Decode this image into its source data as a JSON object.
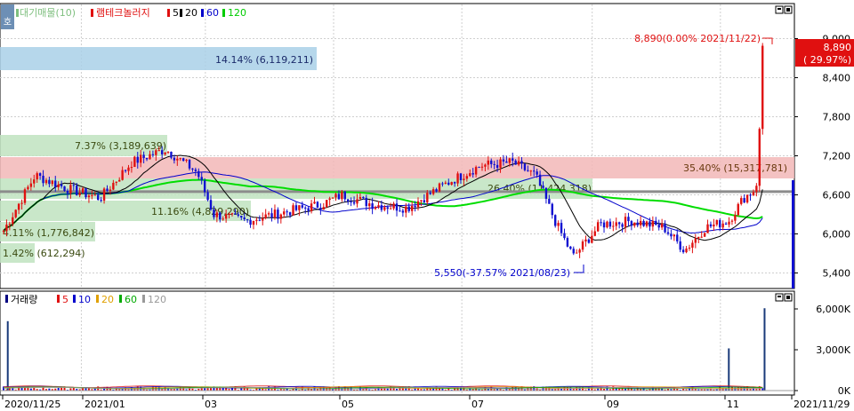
{
  "top_legend": {
    "mode_label": "호",
    "items": [
      {
        "label": "대기매물(10)",
        "color": "#7fbf7f"
      },
      {
        "label": "램테크놀러지",
        "color": "#e01010"
      },
      {
        "label": "5",
        "color": "#e01010"
      },
      {
        "label": "20",
        "color": "#000000"
      },
      {
        "label": "60",
        "color": "#0000cc"
      },
      {
        "label": "120",
        "color": "#00cc00"
      }
    ]
  },
  "bottom_legend": {
    "items": [
      {
        "label": "거래량",
        "color": "#000080"
      },
      {
        "label": "5",
        "color": "#e01010"
      },
      {
        "label": "10",
        "color": "#0000cc"
      },
      {
        "label": "20",
        "color": "#e0a000"
      },
      {
        "label": "60",
        "color": "#00aa00"
      },
      {
        "label": "120",
        "color": "#999999"
      }
    ]
  },
  "price_axis": {
    "ticks": [
      "9,000",
      "8,400",
      "7,800",
      "7,200",
      "6,600",
      "6,000",
      "5,400"
    ]
  },
  "volume_axis": {
    "ticks": [
      "6,000K",
      "3,000K",
      "0K"
    ]
  },
  "x_axis": {
    "ticks": [
      "2020/11/25",
      "2021/01",
      "03",
      "05",
      "07",
      "09",
      "11",
      "2021/11/29"
    ]
  },
  "price_tag": {
    "price": "8,890",
    "pct": "( 29.97%)"
  },
  "annotations": {
    "high": "8,890(0.00% 2021/11/22)",
    "low": "5,550(-37.57% 2021/08/23)"
  },
  "volume_profile": [
    {
      "label": "14.14% (6,119,211)",
      "color": "#a9d0e8"
    },
    {
      "label": "7.37% (3,189,639)",
      "color": "#bfe3bf"
    },
    {
      "label": "35.40% (15,317,781)",
      "color": "#f2b7b7"
    },
    {
      "label": "26.40% (11,424,318)",
      "color": "#bfe3bf"
    },
    {
      "label": "11.16% (4,829,290)",
      "color": "#bfe3bf"
    },
    {
      "label": "4.11% (1,776,842)",
      "color": "#bfe3bf"
    },
    {
      "label": "1.42% (612,294)",
      "color": "#bfe3bf"
    }
  ],
  "chart_data": {
    "type": "candlestick",
    "ticker": "램테크놀러지",
    "period": [
      "2020/11/25",
      "2021/11/29"
    ],
    "current_price": 8890,
    "current_change_pct": 29.97,
    "high": {
      "price": 8890,
      "date": "2021/11/22",
      "pct_from": 0.0
    },
    "low": {
      "price": 5550,
      "date": "2021/08/23",
      "pct_from": -37.57
    },
    "price_ylim": [
      5200,
      9200
    ],
    "volume_ylim_k": [
      0,
      6400
    ],
    "reference_line": 6650,
    "close_path": [
      [
        "2020/11/25",
        6050
      ],
      [
        "2020/12/10",
        6900
      ],
      [
        "2020/12/25",
        6700
      ],
      [
        "2021/01/10",
        6550
      ],
      [
        "2021/01/25",
        7100
      ],
      [
        "2021/02/10",
        7300
      ],
      [
        "2021/02/25",
        6950
      ],
      [
        "2021/03/05",
        6300
      ],
      [
        "2021/03/20",
        6200
      ],
      [
        "2021/04/10",
        6350
      ],
      [
        "2021/04/25",
        6450
      ],
      [
        "2021/05/05",
        6600
      ],
      [
        "2021/05/20",
        6450
      ],
      [
        "2021/06/05",
        6400
      ],
      [
        "2021/06/25",
        6800
      ],
      [
        "2021/07/10",
        7050
      ],
      [
        "2021/07/25",
        7100
      ],
      [
        "2021/08/05",
        6900
      ],
      [
        "2021/08/15",
        6150
      ],
      [
        "2021/08/23",
        5650
      ],
      [
        "2021/09/05",
        6150
      ],
      [
        "2021/09/20",
        6200
      ],
      [
        "2021/10/05",
        6100
      ],
      [
        "2021/10/15",
        5750
      ],
      [
        "2021/10/25",
        6100
      ],
      [
        "2021/11/05",
        6200
      ],
      [
        "2021/11/12",
        6550
      ],
      [
        "2021/11/18",
        6700
      ],
      [
        "2021/11/22",
        8890
      ]
    ],
    "volume_spikes_k": [
      [
        "2020/11/27",
        5100
      ],
      [
        "2021/11/05",
        3100
      ],
      [
        "2021/11/22",
        6050
      ]
    ],
    "volume_profile_pct": [
      14.14,
      7.37,
      35.4,
      26.4,
      11.16,
      4.11,
      1.42
    ],
    "volume_profile_qty": [
      6119211,
      3189639,
      15317781,
      11424318,
      4829290,
      1776842,
      612294
    ]
  }
}
